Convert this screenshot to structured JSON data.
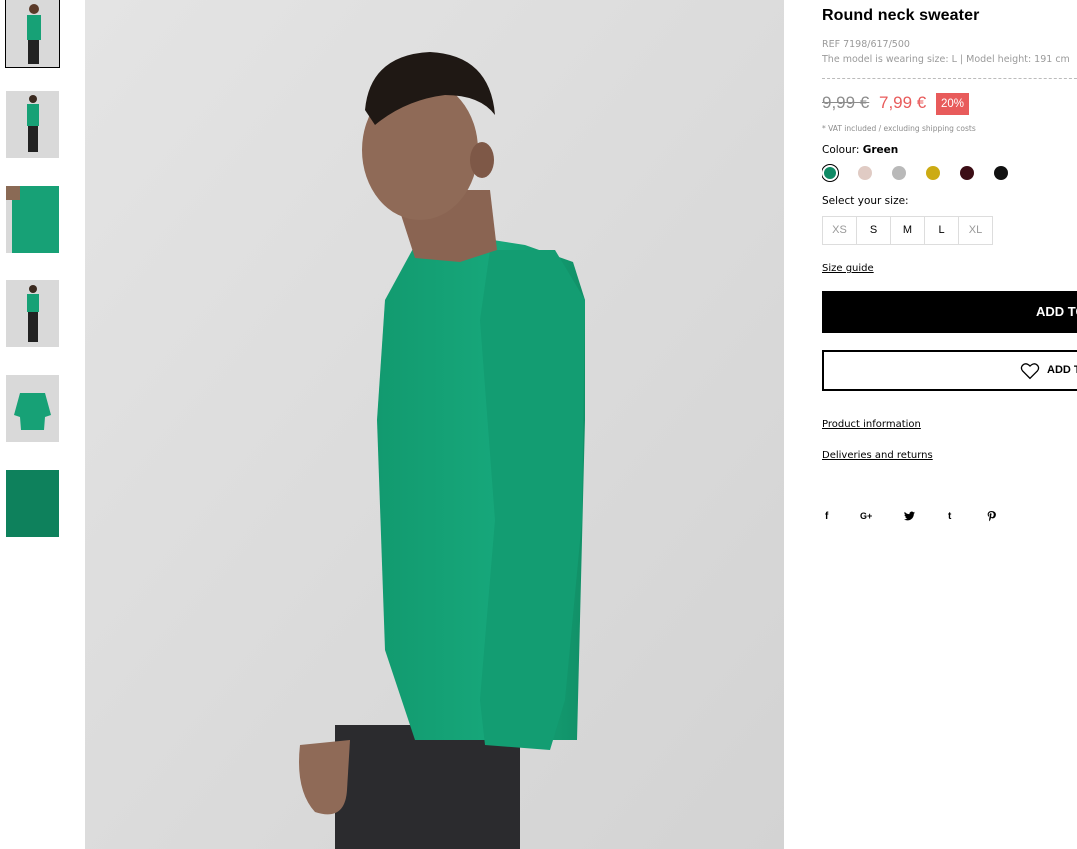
{
  "product": {
    "title": "Round neck sweater",
    "ref": "REF 7198/617/500",
    "model_info": "The model is wearing size: L | Model height: 191 cm",
    "price_old": "9,99 €",
    "price_new": "7,99 €",
    "discount": "20%",
    "vat_note": "* VAT included / excluding shipping costs",
    "colour_label": "Colour: ",
    "colour_value": "Green",
    "colours": [
      "#0f8a65",
      "#e0cbc4",
      "#b9b9b9",
      "#ccab13",
      "#3c0d15",
      "#111111"
    ],
    "selected_colour_index": 0,
    "size_label": "Select your size:",
    "sizes": [
      "XS",
      "S",
      "M",
      "L",
      "XL"
    ],
    "size_guide": "Size guide",
    "add_to_cart": "ADD TO",
    "add_to_wishlist": "ADD T",
    "product_information": "Product information",
    "deliveries_returns": "Deliveries and returns",
    "social": [
      "f",
      "G+",
      "twitter-icon",
      "t",
      "pinterest-icon"
    ]
  },
  "colors": {
    "accent_sale": "#e85b5b",
    "sweater_green": "#14a377"
  }
}
